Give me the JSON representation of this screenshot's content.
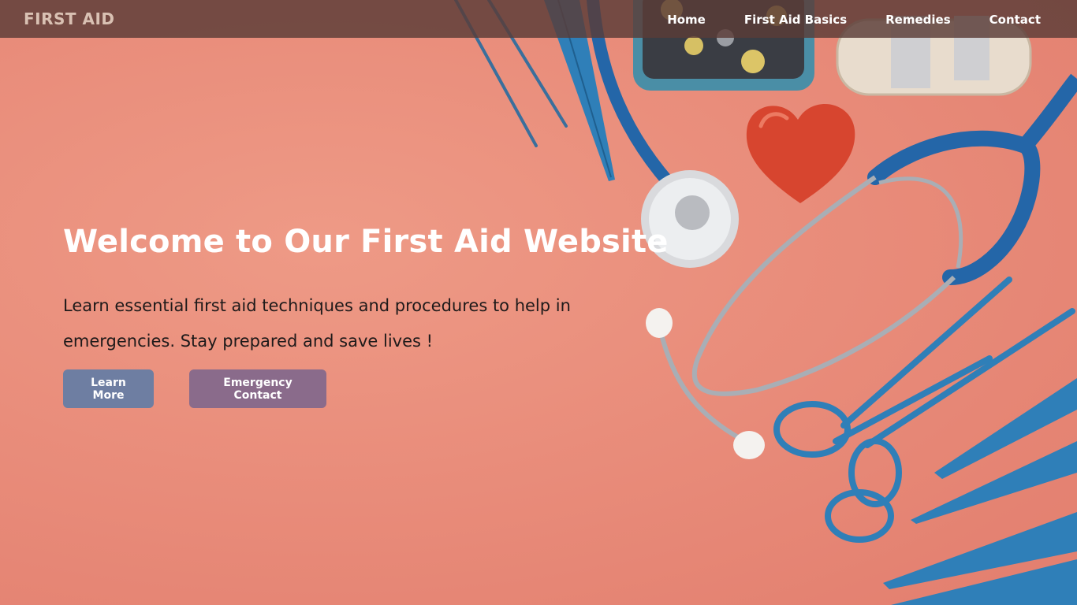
{
  "brand": "FIRST AID",
  "nav": {
    "home": "Home",
    "basics": "First Aid Basics",
    "remedies": "Remedies",
    "contact": "Contact"
  },
  "hero": {
    "title": "Welcome to Our First Aid Website",
    "description": "Learn essential first aid techniques and procedures to help in emergencies. Stay prepared and save lives !",
    "learn_more": "Learn More",
    "emergency_contact": "Emergency Contact"
  },
  "colors": {
    "background": "#e98d7b",
    "navbar": "#5a3c37",
    "learn_button": "#6e7ea2",
    "emergency_button": "#8a6b8b",
    "instrument_blue": "#2f7fb8"
  }
}
